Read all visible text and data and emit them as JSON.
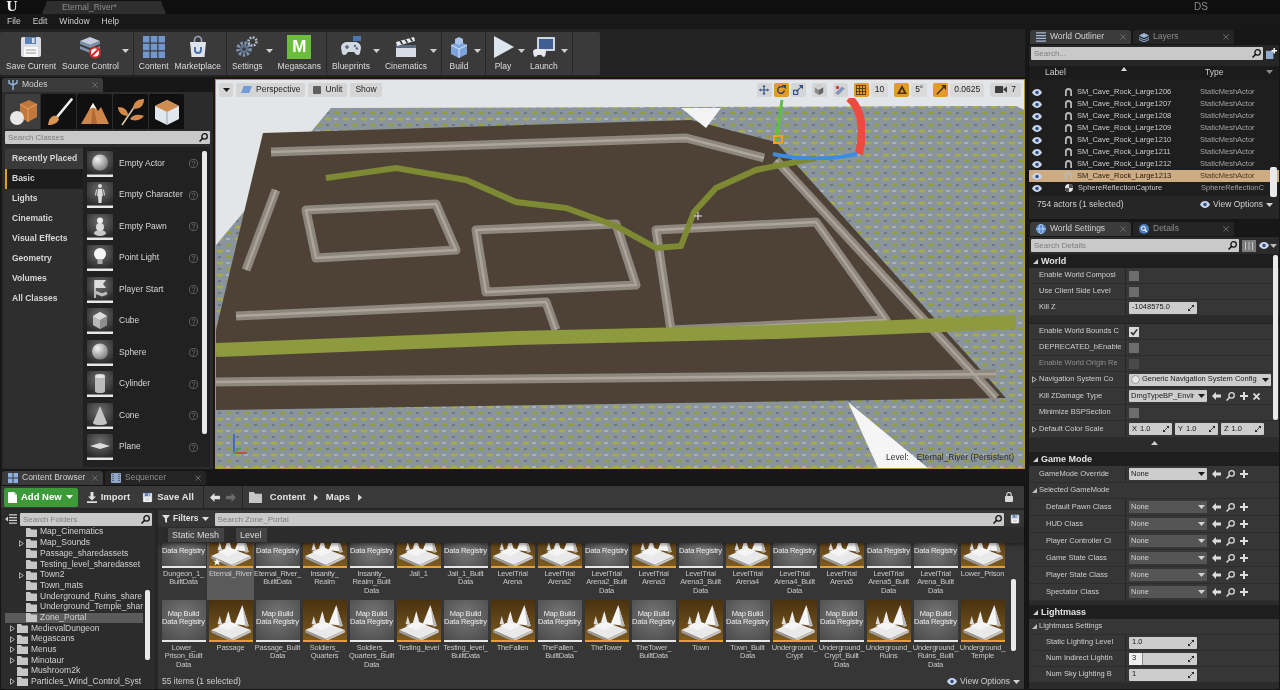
{
  "title_bar": {
    "logo_text": "U",
    "document_tab": "Eternal_River*",
    "user_initials": "DS"
  },
  "menu": [
    "File",
    "Edit",
    "Window",
    "Help"
  ],
  "toolbar": {
    "groups": [
      {
        "buttons": [
          {
            "kind": "save",
            "label": "Save Current",
            "dropdown": false
          },
          {
            "kind": "source_control",
            "label": "Source Control",
            "dropdown": true
          }
        ]
      },
      {
        "buttons": [
          {
            "kind": "content",
            "label": "Content",
            "dropdown": false
          },
          {
            "kind": "marketplace",
            "label": "Marketplace",
            "dropdown": false
          }
        ]
      },
      {
        "buttons": [
          {
            "kind": "settings",
            "label": "Settings",
            "dropdown": true
          },
          {
            "kind": "megascans",
            "label": "Megascans",
            "dropdown": false,
            "logo_text": "M"
          }
        ]
      },
      {
        "buttons": [
          {
            "kind": "blueprints",
            "label": "Blueprints",
            "dropdown": true
          },
          {
            "kind": "cinematics",
            "label": "Cinematics",
            "dropdown": true
          }
        ]
      },
      {
        "buttons": [
          {
            "kind": "build",
            "label": "Build",
            "dropdown": true
          }
        ]
      },
      {
        "buttons": [
          {
            "kind": "play",
            "label": "Play",
            "dropdown": true
          },
          {
            "kind": "launch",
            "label": "Launch",
            "dropdown": true
          }
        ]
      }
    ]
  },
  "modes": {
    "tab": "Modes",
    "mode_tabs": [
      {
        "kind": "place",
        "selected": true
      },
      {
        "kind": "paint",
        "selected": false
      },
      {
        "kind": "landscape",
        "selected": false
      },
      {
        "kind": "foliage",
        "selected": false
      },
      {
        "kind": "geometry",
        "selected": false
      }
    ],
    "search": {
      "placeholder": "Search Classes"
    },
    "categories": [
      {
        "label": "Recently Placed",
        "selected": false,
        "hovered": true
      },
      {
        "label": "Basic",
        "selected": true,
        "hovered": false
      },
      {
        "label": "Lights",
        "selected": false,
        "hovered": false
      },
      {
        "label": "Cinematic",
        "selected": false,
        "hovered": false
      },
      {
        "label": "Visual Effects",
        "selected": false,
        "hovered": false
      },
      {
        "label": "Geometry",
        "selected": false,
        "hovered": false
      },
      {
        "label": "Volumes",
        "selected": false,
        "hovered": false
      },
      {
        "label": "All Classes",
        "selected": false,
        "hovered": false
      }
    ],
    "items": [
      {
        "kind": "empty_actor",
        "label": "Empty Actor"
      },
      {
        "kind": "character",
        "label": "Empty Character"
      },
      {
        "kind": "pawn",
        "label": "Empty Pawn"
      },
      {
        "kind": "point_light",
        "label": "Point Light"
      },
      {
        "kind": "player_start",
        "label": "Player Start"
      },
      {
        "kind": "cube",
        "label": "Cube"
      },
      {
        "kind": "sphere",
        "label": "Sphere"
      },
      {
        "kind": "cylinder",
        "label": "Cylinder"
      },
      {
        "kind": "cone",
        "label": "Cone"
      },
      {
        "kind": "plane",
        "label": "Plane"
      }
    ]
  },
  "viewport": {
    "left_buttons": [
      {
        "kind": "menu"
      },
      {
        "kind": "perspective",
        "label": "Perspective"
      },
      {
        "kind": "view_mode",
        "label": "Unlit"
      },
      {
        "kind": "show",
        "label": "Show"
      }
    ],
    "transform_tools": [
      {
        "kind": "translate",
        "selected": false
      },
      {
        "kind": "rotate",
        "selected": true
      },
      {
        "kind": "scale",
        "selected": false
      }
    ],
    "toggles": [
      {
        "kind": "coordinate_space"
      },
      {
        "kind": "surface_snap"
      }
    ],
    "snaps": [
      {
        "kind": "grid",
        "on": true,
        "value": "10"
      },
      {
        "kind": "rotation",
        "on": true,
        "value": "5°"
      },
      {
        "kind": "scale",
        "on": true,
        "value": "0.0625"
      }
    ],
    "camera_speed": "7",
    "level_label": "Level:",
    "level_name": "Eternal_River (Persistent)"
  },
  "outliner": {
    "tabs": [
      {
        "kind": "outliner",
        "label": "World Outliner",
        "selected": true
      },
      {
        "kind": "layers",
        "label": "Layers",
        "selected": false
      }
    ],
    "search": {
      "placeholder": "Search..."
    },
    "columns": [
      "Label",
      "Type"
    ],
    "rows": [
      {
        "kind": "static_mesh",
        "visible": true,
        "label": "SM_Cave_Rock_Large1206",
        "type": "StaticMeshActor",
        "selected": false
      },
      {
        "kind": "static_mesh",
        "visible": true,
        "label": "SM_Cave_Rock_Large1207",
        "type": "StaticMeshActor",
        "selected": false
      },
      {
        "kind": "static_mesh",
        "visible": true,
        "label": "SM_Cave_Rock_Large1208",
        "type": "StaticMeshActor",
        "selected": false
      },
      {
        "kind": "static_mesh",
        "visible": true,
        "label": "SM_Cave_Rock_Large1209",
        "type": "StaticMeshActor",
        "selected": false
      },
      {
        "kind": "static_mesh",
        "visible": true,
        "label": "SM_Cave_Rock_Large1210",
        "type": "StaticMeshActor",
        "selected": false
      },
      {
        "kind": "static_mesh",
        "visible": true,
        "label": "SM_Cave_Rock_Large1211",
        "type": "StaticMeshActor",
        "selected": false
      },
      {
        "kind": "static_mesh",
        "visible": true,
        "label": "SM_Cave_Rock_Large1212",
        "type": "StaticMeshActor",
        "selected": false
      },
      {
        "kind": "static_mesh",
        "visible": true,
        "label": "SM_Cave_Rock_Large1213",
        "type": "StaticMeshActor",
        "selected": true
      },
      {
        "kind": "reflection_capture",
        "visible": true,
        "label": "SphereReflectionCapture",
        "type": "SphereReflectionC",
        "selected": false
      }
    ],
    "status": "754 actors (1 selected)",
    "view_options": "View Options"
  },
  "details": {
    "tabs": [
      {
        "kind": "world_settings",
        "label": "World Settings",
        "selected": true
      },
      {
        "kind": "details",
        "label": "Details",
        "selected": false
      }
    ],
    "search": {
      "placeholder": "Search Details"
    },
    "sections": [
      {
        "title": "World",
        "expanded": true,
        "rows": [
          {
            "kind": "checkbox",
            "label": "Enable World Composi",
            "expandable": false,
            "checked": false,
            "disabled": false
          },
          {
            "kind": "checkbox",
            "label": "Use Client Side Level",
            "expandable": false,
            "checked": false,
            "disabled": false
          },
          {
            "kind": "number",
            "label": "Kill Z",
            "expandable": false,
            "value": "-1048575.0"
          }
        ],
        "advanced_expanded": true,
        "advanced_rows": [
          {
            "kind": "checkbox",
            "label": "Enable World Bounds C",
            "expandable": false,
            "checked": true,
            "disabled": false
          },
          {
            "kind": "checkbox",
            "label": "DEPRECATED_bEnable",
            "expandable": false,
            "checked": false,
            "disabled": false
          },
          {
            "kind": "checkbox",
            "label": "Enable World Origin Re",
            "expandable": false,
            "checked": false,
            "disabled": true
          },
          {
            "kind": "combo",
            "label": "Navigation System Co",
            "expandable": true,
            "value": "Generic Navigation System Config"
          },
          {
            "kind": "asset",
            "label": "Kill ZDamage Type",
            "expandable": false,
            "value": "DmgTypeBP_Envir",
            "clearable": true,
            "disabled": false
          },
          {
            "kind": "checkbox",
            "label": "Minimize BSPSection",
            "expandable": false,
            "checked": false,
            "disabled": false
          },
          {
            "kind": "vector",
            "label": "Default Color Scale",
            "expandable": true,
            "values": [
              {
                "axis": "X",
                "value": "1.0"
              },
              {
                "axis": "Y",
                "value": "1.0"
              },
              {
                "axis": "Z",
                "value": "1.0"
              }
            ]
          }
        ]
      },
      {
        "title": "Game Mode",
        "expanded": true,
        "rows": [
          {
            "kind": "asset",
            "label": "GameMode Override",
            "expandable": false,
            "value": "None",
            "clearable": false,
            "disabled": false
          },
          {
            "kind": "group",
            "label": "Selected GameMode",
            "expanded": true,
            "children": [
              {
                "kind": "asset",
                "label": "Default Pawn Class",
                "expandable": false,
                "value": "None",
                "clearable": false,
                "disabled": true
              },
              {
                "kind": "asset",
                "label": "HUD Class",
                "expandable": false,
                "value": "None",
                "clearable": false,
                "disabled": true
              },
              {
                "kind": "asset",
                "label": "Player Controller Cl",
                "expandable": false,
                "value": "None",
                "clearable": false,
                "disabled": true
              },
              {
                "kind": "asset",
                "label": "Game State Class",
                "expandable": false,
                "value": "None",
                "clearable": false,
                "disabled": true
              },
              {
                "kind": "asset",
                "label": "Player State Class",
                "expandable": false,
                "value": "None",
                "clearable": false,
                "disabled": true
              },
              {
                "kind": "asset",
                "label": "Spectator Class",
                "expandable": false,
                "value": "None",
                "clearable": false,
                "disabled": true
              }
            ]
          }
        ]
      },
      {
        "title": "Lightmass",
        "expanded": true,
        "rows": [
          {
            "kind": "group",
            "label": "Lightmass Settings",
            "expanded": true,
            "children": [
              {
                "kind": "number",
                "label": "Static Lighting Level",
                "expandable": false,
                "value": "1.0"
              },
              {
                "kind": "number",
                "label": "Num Indirect Lightin",
                "expandable": false,
                "value": "3",
                "level": 0.2
              },
              {
                "kind": "number",
                "label": "Num Sky Lighting B",
                "expandable": false,
                "value": "1"
              }
            ]
          }
        ]
      }
    ]
  },
  "content_browser": {
    "tabs": [
      {
        "kind": "content_browser",
        "label": "Content Browser",
        "selected": true
      },
      {
        "kind": "sequencer",
        "label": "Sequencer",
        "selected": false
      }
    ],
    "actions": [
      {
        "kind": "add_new",
        "label": "Add New",
        "dropdown": true
      },
      {
        "kind": "import",
        "label": "Import",
        "dropdown": false
      },
      {
        "kind": "save_all",
        "label": "Save All",
        "dropdown": false
      }
    ],
    "nav": [
      {
        "kind": "back",
        "disabled": false
      },
      {
        "kind": "forward",
        "disabled": true
      }
    ],
    "path": [
      "Content",
      "Maps"
    ],
    "folder_search": {
      "placeholder": "Search Folders"
    },
    "folders": [
      {
        "children": [
          {
            "label": "Map_Cinematics",
            "expandable": false,
            "selected": false
          },
          {
            "label": "Map_Sounds",
            "expandable": true,
            "selected": false
          },
          {
            "label": "Passage_sharedassets",
            "expandable": false,
            "selected": false
          },
          {
            "label": "Testing_level_sharedasset",
            "expandable": false,
            "selected": false
          },
          {
            "label": "Town2",
            "expandable": true,
            "selected": false
          },
          {
            "label": "Town_mats",
            "expandable": false,
            "selected": false
          },
          {
            "label": "Underground_Ruins_share",
            "expandable": false,
            "selected": false
          },
          {
            "label": "Underground_Temple_shar",
            "expandable": false,
            "selected": false
          },
          {
            "label": "Zone_Portal",
            "expandable": false,
            "selected": true
          }
        ]
      },
      {
        "label": "MedievalDungeon",
        "expandable": true,
        "selected": false
      },
      {
        "label": "Megascans",
        "expandable": true,
        "selected": false
      },
      {
        "label": "Menus",
        "expandable": true,
        "selected": false
      },
      {
        "label": "Minotaur",
        "expandable": true,
        "selected": false
      },
      {
        "label": "Mushroom2k",
        "expandable": false,
        "selected": false
      },
      {
        "label": "Particles_Wind_Control_Syst",
        "expandable": true,
        "selected": false
      }
    ],
    "filters_label": "Filters",
    "asset_search": {
      "placeholder": "Search Zone_Portal"
    },
    "filter_chips": [
      "Static Mesh",
      "Level"
    ],
    "asset_rows": [
      {
        "assets": [
          {
            "name": "Dungeon_1_BuiltData",
            "kind": "build_data",
            "thumbnail_text": "Data Registry",
            "selected": false,
            "modified": false
          },
          {
            "name": "Eternal_River",
            "kind": "level",
            "selected": true,
            "modified": true
          },
          {
            "name": "Eternal_River_BuiltData",
            "kind": "build_data",
            "thumbnail_text": "Data Registry",
            "selected": false,
            "modified": false
          },
          {
            "name": "Insanity_Realm",
            "kind": "level",
            "selected": false,
            "modified": false
          },
          {
            "name": "Insanity_Realm_BuiltData",
            "kind": "build_data",
            "thumbnail_text": "Data Registry",
            "selected": false,
            "modified": false
          },
          {
            "name": "Jail_1",
            "kind": "level",
            "selected": false,
            "modified": false
          },
          {
            "name": "Jail_1_BuiltData",
            "kind": "build_data",
            "thumbnail_text": "Data Registry",
            "selected": false,
            "modified": false
          },
          {
            "name": "LevelTrialArena",
            "kind": "level",
            "selected": false,
            "modified": false
          },
          {
            "name": "LevelTrialArena2",
            "kind": "level",
            "selected": false,
            "modified": false
          },
          {
            "name": "LevelTrialArena2_BuiltData",
            "kind": "build_data",
            "thumbnail_text": "Data Registry",
            "selected": false,
            "modified": false
          },
          {
            "name": "LevelTrialArena3",
            "kind": "level",
            "selected": false,
            "modified": false
          },
          {
            "name": "LevelTrialArena3_BuiltData",
            "kind": "build_data",
            "thumbnail_text": "Data Registry",
            "selected": false,
            "modified": false
          },
          {
            "name": "LevelTrialArena4",
            "kind": "level",
            "selected": false,
            "modified": false
          },
          {
            "name": "LevelTrialArena4_BuiltData",
            "kind": "build_data",
            "thumbnail_text": "Data Registry",
            "selected": false,
            "modified": false
          },
          {
            "name": "LevelTrialArena5",
            "kind": "level",
            "selected": false,
            "modified": false
          },
          {
            "name": "LevelTrialArena5_BuiltData",
            "kind": "build_data",
            "thumbnail_text": "Data Registry",
            "selected": false,
            "modified": false
          },
          {
            "name": "LevelTrialArena_BuiltData",
            "kind": "build_data",
            "thumbnail_text": "Data Registry",
            "selected": false,
            "modified": false
          },
          {
            "name": "Lower_Prison",
            "kind": "level",
            "selected": false,
            "modified": false
          }
        ]
      },
      {
        "assets": [
          {
            "name": "Lower_Prison_BuiltData",
            "kind": "build_data",
            "thumbnail_text": "Map Build Data Registry",
            "selected": false,
            "modified": false
          },
          {
            "name": "Passage",
            "kind": "level",
            "selected": false,
            "modified": false
          },
          {
            "name": "Passage_BuiltData",
            "kind": "build_data",
            "thumbnail_text": "Map Build Data Registry",
            "selected": false,
            "modified": false
          },
          {
            "name": "Soldiers_Quarters",
            "kind": "level",
            "selected": false,
            "modified": false
          },
          {
            "name": "Soldiers_Quarters_BuiltData",
            "kind": "build_data",
            "thumbnail_text": "Map Build Data Registry",
            "selected": false,
            "modified": false
          },
          {
            "name": "Testing_level",
            "kind": "level",
            "selected": false,
            "modified": false
          },
          {
            "name": "Testing_level_BuiltData",
            "kind": "build_data",
            "thumbnail_text": "Map Build Data Registry",
            "selected": false,
            "modified": false
          },
          {
            "name": "TheFallen",
            "kind": "level",
            "selected": false,
            "modified": false
          },
          {
            "name": "TheFallen_BuiltData",
            "kind": "build_data",
            "thumbnail_text": "Map Build Data Registry",
            "selected": false,
            "modified": false
          },
          {
            "name": "TheTower",
            "kind": "level",
            "selected": false,
            "modified": false
          },
          {
            "name": "TheTower_BuiltData",
            "kind": "build_data",
            "thumbnail_text": "Map Build Data Registry",
            "selected": false,
            "modified": false
          },
          {
            "name": "Town",
            "kind": "level",
            "selected": false,
            "modified": false
          },
          {
            "name": "Town_BuiltData",
            "kind": "build_data",
            "thumbnail_text": "Map Build Data Registry",
            "selected": false,
            "modified": false
          },
          {
            "name": "Underground_Crypt",
            "kind": "level",
            "selected": false,
            "modified": false
          },
          {
            "name": "Underground_Crypt_BuiltData",
            "kind": "build_data",
            "thumbnail_text": "Map Build Data Registry",
            "selected": false,
            "modified": false
          },
          {
            "name": "Underground_Ruins",
            "kind": "level",
            "selected": false,
            "modified": false
          },
          {
            "name": "Underground_Ruins_BuiltData",
            "kind": "build_data",
            "thumbnail_text": "Map Build Data Registry",
            "selected": false,
            "modified": false
          },
          {
            "name": "Underground_Temple",
            "kind": "level",
            "selected": false,
            "modified": false
          }
        ]
      }
    ],
    "status": "55 items (1 selected)",
    "view_options": "View Options"
  }
}
